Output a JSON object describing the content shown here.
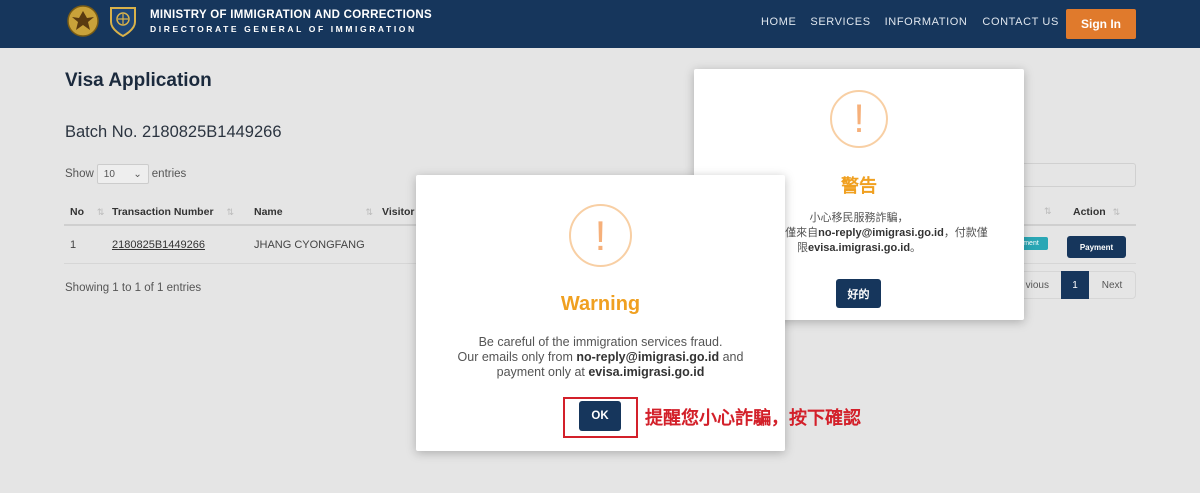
{
  "header": {
    "brand_line1": "MINISTRY OF IMMIGRATION AND CORRECTIONS",
    "brand_line2": "DIRECTORATE GENERAL OF IMMIGRATION",
    "nav": [
      "HOME",
      "SERVICES",
      "INFORMATION",
      "CONTACT US"
    ],
    "signin_label": "Sign In"
  },
  "page": {
    "title": "Visa Application",
    "batch": "Batch No. 2180825B1449266",
    "show_label": "Show",
    "entries_value": "10",
    "entries_label": "entries"
  },
  "table": {
    "headers": [
      "No",
      "Transaction Number",
      "Name",
      "Visitor",
      "Action"
    ],
    "rows": [
      {
        "no": "1",
        "transaction": "2180825B1449266",
        "name": "JHANG CYONGFANG",
        "status": "ment",
        "action": "Payment"
      }
    ],
    "showing": "Showing 1 to 1 of 1 entries",
    "pager": {
      "prev": "vious",
      "current": "1",
      "next": "Next"
    }
  },
  "dialog_en": {
    "icon": "!",
    "title": "Warning",
    "line1": "Be careful of the immigration services fraud.",
    "line2_pre": "Our emails only from ",
    "line2_bold": "no-reply@imigrasi.go.id",
    "line2_post": " and",
    "line3_pre": "payment only at ",
    "line3_bold": "evisa.imigrasi.go.id",
    "ok_label": "OK"
  },
  "dialog_zh": {
    "icon": "!",
    "title": "警告",
    "line1": "小心移民服務詐騙，",
    "line2_pre": "我們的郵件僅來自",
    "line2_bold": "no-reply@imigrasi.go.id",
    "line2_post": "，付款僅",
    "line3_pre": "限",
    "line3_bold": "evisa.imigrasi.go.id",
    "line3_post": "。",
    "ok_label": "好的"
  },
  "annotation": "提醒您小心詐騙，按下確認",
  "colors": {
    "header_bg": "#16365c",
    "signin_bg": "#e07a2c",
    "warning": "#f0a020",
    "annotation": "#d3202a"
  }
}
